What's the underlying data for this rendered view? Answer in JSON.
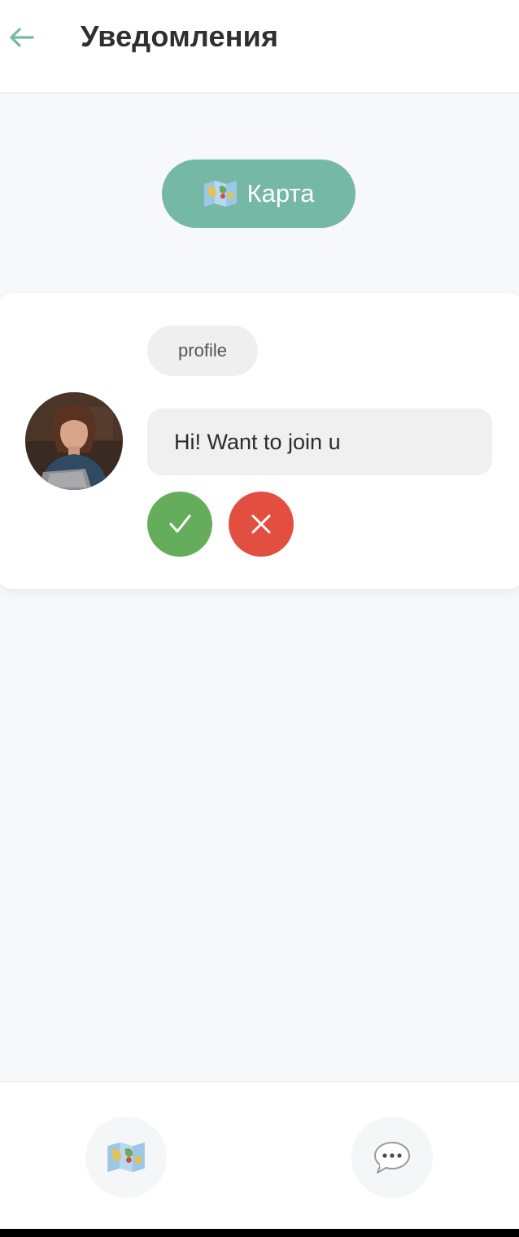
{
  "header": {
    "title": "Уведомления",
    "back_icon": "arrow-left-icon",
    "accent_color": "#75b8a6"
  },
  "map_button": {
    "icon": "map-icon",
    "label": "Карта",
    "color": "#75b8a6"
  },
  "notification": {
    "profile_label": "profile",
    "message": "Hi! Want to join u",
    "avatar": "user-avatar",
    "accept_icon": "checkmark-icon",
    "accept_color": "#64ae5b",
    "decline_icon": "close-icon",
    "decline_color": "#e24f40"
  },
  "bottom_nav": {
    "items": [
      {
        "icon": "map-icon"
      },
      {
        "icon": "chat-bubble-icon"
      }
    ]
  }
}
